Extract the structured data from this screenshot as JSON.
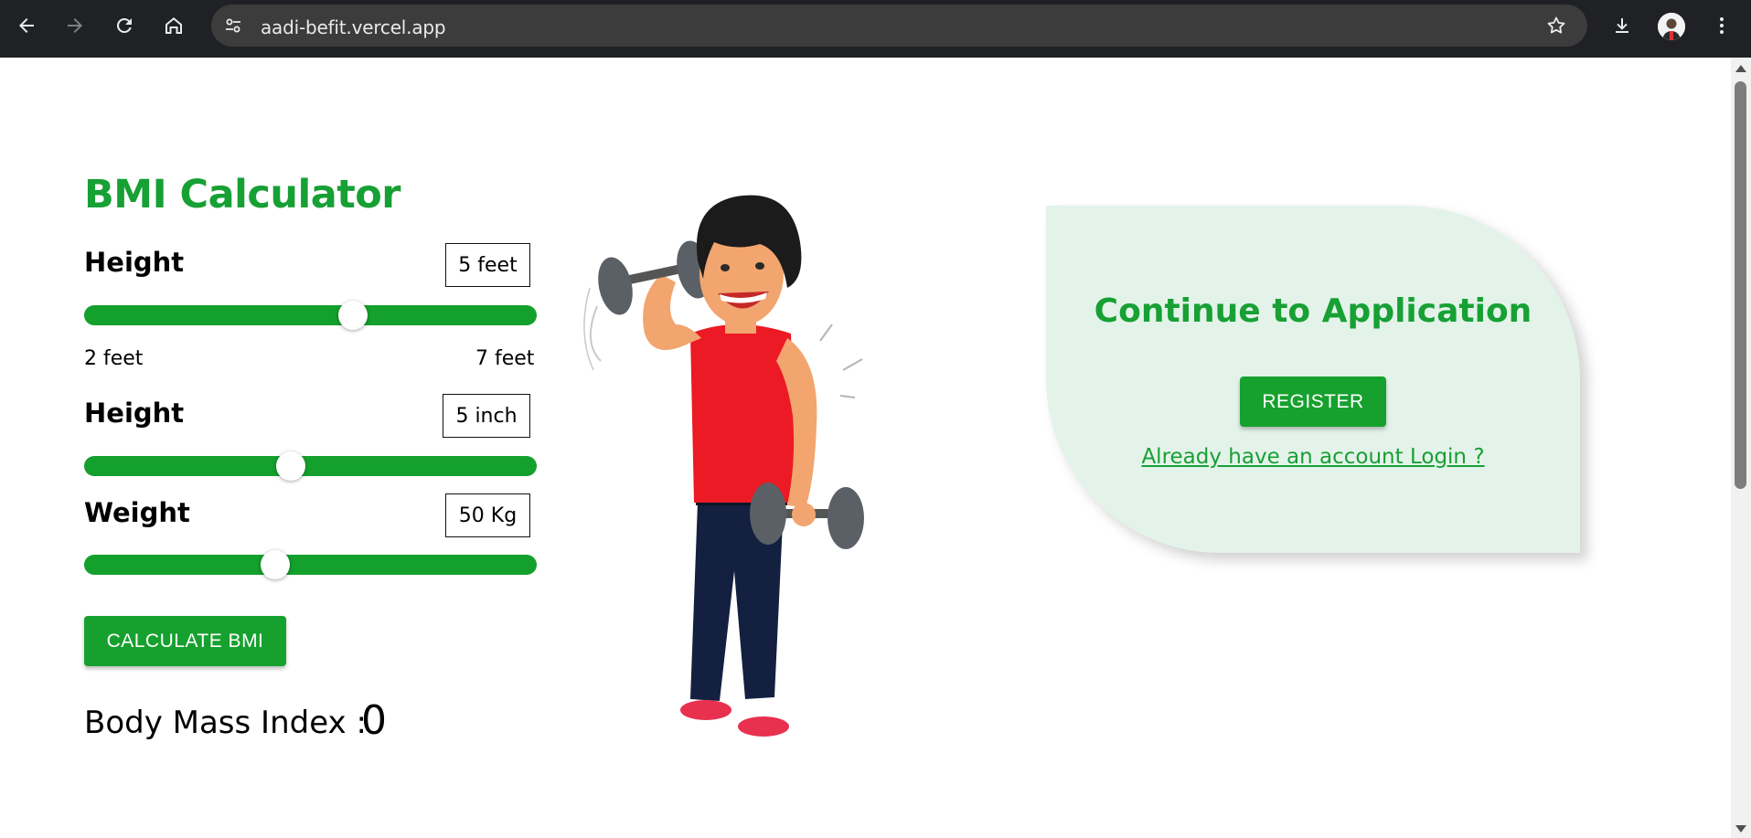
{
  "browser": {
    "url": "aadi-befit.vercel.app",
    "icons": [
      "back-icon",
      "forward-icon",
      "reload-icon",
      "home-icon",
      "site-settings-icon",
      "bookmark-star-icon",
      "download-icon",
      "profile-avatar",
      "menu-icon"
    ]
  },
  "bmi": {
    "title": "BMI Calculator",
    "height_feet": {
      "label": "Height",
      "value_text": "5 feet",
      "min_label": "2 feet",
      "max_label": "7 feet",
      "value": 5,
      "min": 2,
      "max": 7
    },
    "height_inch": {
      "label": "Height",
      "value_text": "5 inch",
      "value": 5
    },
    "weight": {
      "label": "Weight",
      "value_text": "50 Kg",
      "value": 50
    },
    "calculate_label": "CALCULATE BMI",
    "result_label": "Body Mass Index :",
    "result_value": "0"
  },
  "auth_card": {
    "title": "Continue to Application",
    "register_label": "REGISTER",
    "login_link": "Already have an account Login ?"
  },
  "colors": {
    "accent": "#14a02c",
    "card_bg": "#e4f3ea",
    "chrome_bg": "#202124"
  }
}
